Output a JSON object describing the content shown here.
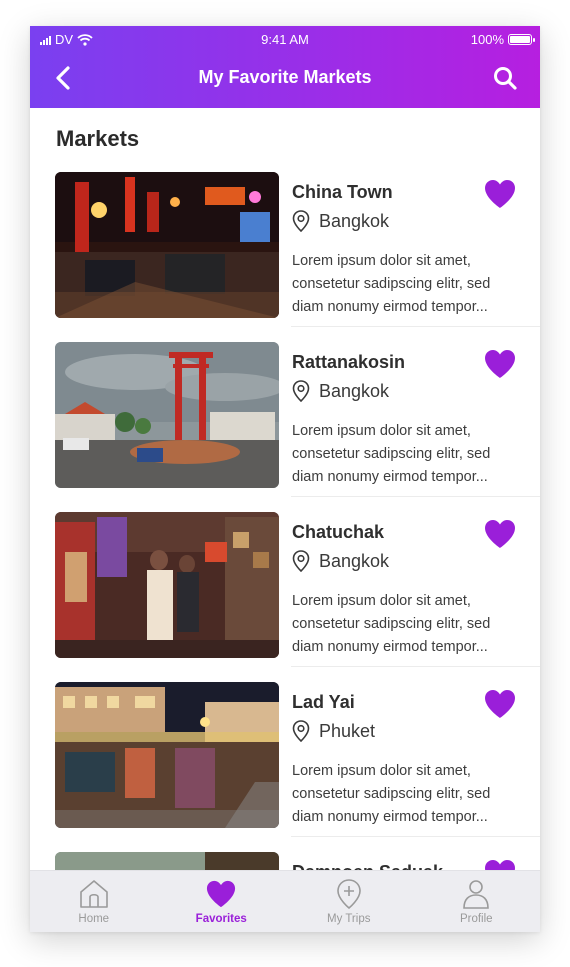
{
  "status_bar": {
    "carrier": "DV",
    "time": "9:41 AM",
    "battery": "100%"
  },
  "header": {
    "title": "My Favorite Markets",
    "back_icon": "chevron-left-icon",
    "search_icon": "search-icon"
  },
  "colors": {
    "gradient_start": "#7a40f0",
    "gradient_end": "#b61fe0",
    "accent": "#9a1fd9"
  },
  "section_title": "Markets",
  "markets": [
    {
      "name": "China Town",
      "location": "Bangkok",
      "description": "Lorem ipsum dolor sit amet, consetetur sadipscing elitr, sed diam nonumy eirmod tempor...",
      "favorite": true
    },
    {
      "name": "Rattanakosin",
      "location": "Bangkok",
      "description": "Lorem ipsum dolor sit amet, consetetur sadipscing elitr, sed diam nonumy eirmod tempor...",
      "favorite": true
    },
    {
      "name": "Chatuchak",
      "location": "Bangkok",
      "description": "Lorem ipsum dolor sit amet, consetetur sadipscing elitr, sed diam nonumy eirmod tempor...",
      "favorite": true
    },
    {
      "name": "Lad Yai",
      "location": "Phuket",
      "description": "Lorem ipsum dolor sit amet, consetetur sadipscing elitr, sed diam nonumy eirmod tempor...",
      "favorite": true
    },
    {
      "name": "Damnoen Saduak",
      "location": "",
      "description": "",
      "favorite": true
    }
  ],
  "tabbar": {
    "tabs": [
      {
        "label": "Home",
        "icon": "home-icon"
      },
      {
        "label": "Favorites",
        "icon": "heart-icon",
        "active": true
      },
      {
        "label": "My Trips",
        "icon": "add-location-icon"
      },
      {
        "label": "Profile",
        "icon": "profile-icon"
      }
    ]
  }
}
